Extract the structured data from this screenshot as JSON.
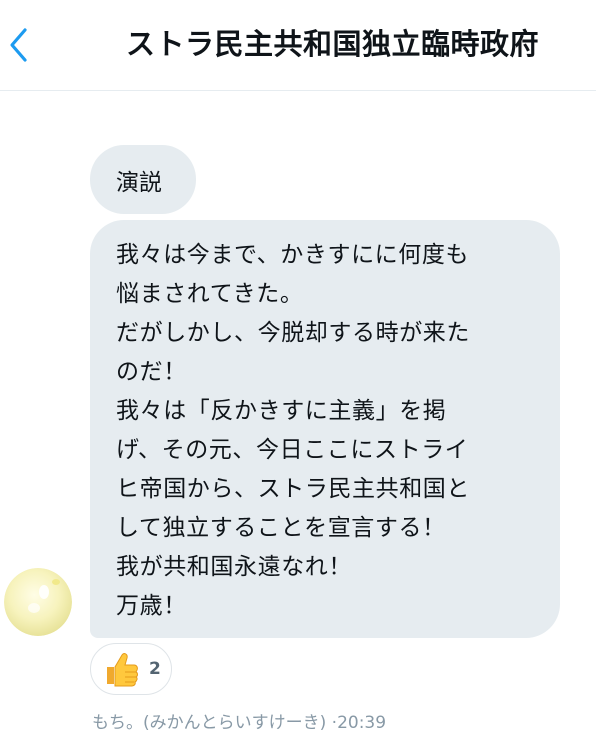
{
  "header": {
    "back_icon": "chevron-left-icon",
    "title": "ストラ民主共和国独立臨時政府"
  },
  "messages": [
    {
      "lines": [
        "演説"
      ]
    },
    {
      "lines": [
        "我々は今まで、かきすにに何度も",
        "悩まされてきた。",
        "だがしかし、今脱却する時が来た",
        "のだ！",
        "我々は「反かきすに主義」を掲",
        "げ、その元、今日ここにストライ",
        "ヒ帝国から、ストラ民主共和国と",
        "して独立することを宣言する！",
        "我が共和国永遠なれ！",
        "万歳！"
      ]
    }
  ],
  "reaction": {
    "icon": "thumbs-up-icon",
    "count": "2"
  },
  "meta": "もち。(みかんとらいすけーき) ·20:39",
  "colors": {
    "accent": "#1d9bf0",
    "bubble": "#e6ecf0",
    "meta": "#8899a6"
  }
}
